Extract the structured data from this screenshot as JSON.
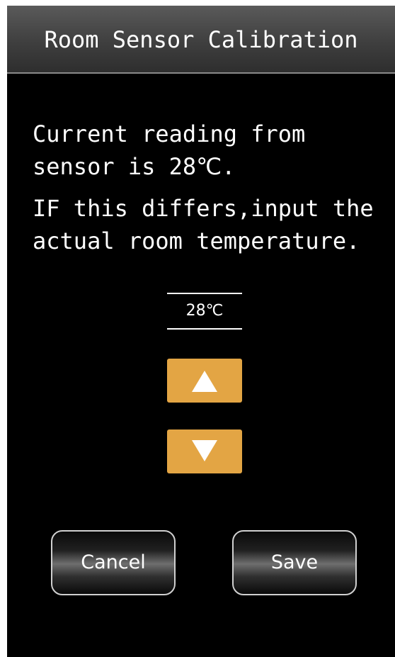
{
  "window": {
    "title": "Room Sensor Calibration"
  },
  "message": {
    "line1": "Current reading from sensor is 28℃.",
    "line2": "IF this differs,input the actual room temperature."
  },
  "temperature": {
    "value": "28℃"
  },
  "controls": {
    "increase_icon": "triangle-up",
    "decrease_icon": "triangle-down",
    "accent_color": "#e3a544"
  },
  "actions": {
    "cancel_label": "Cancel",
    "save_label": "Save"
  }
}
